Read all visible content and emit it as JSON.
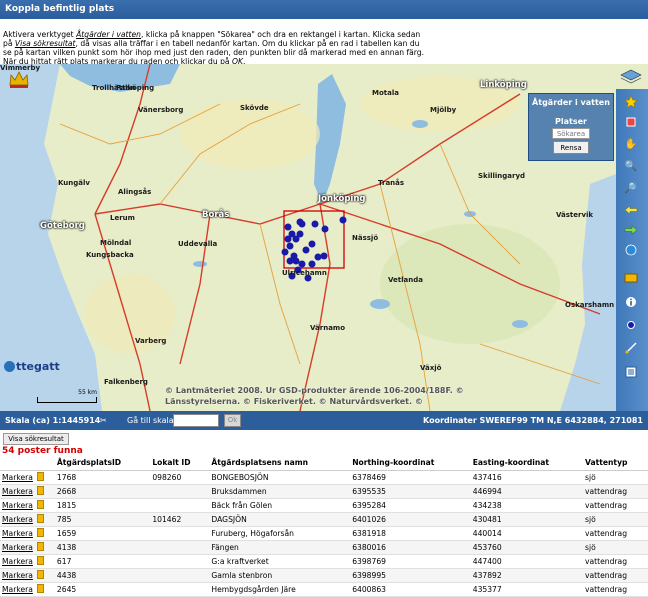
{
  "title": "Koppla befintlig plats",
  "instructions": {
    "line1_a": "Aktivera verktyget ",
    "line1_tool": "Åtgärder i vatten",
    "line1_b": ", klicka på knappen \"Sökarea\" och dra en rektangel i kartan. Klicka sedan",
    "line2_a": "på ",
    "line2_link": "Visa sökresultat",
    "line2_b": ", då visas alla träffar i en tabell nedanför kartan. Om du klickar på en rad i tabellen kan du",
    "line3": "se på kartan vilken punkt som hör ihop med just den raden, den punkten blir då markerad med en annan färg.",
    "line4_a": "När du hittat rätt plats markerar du raden och klickar du på ",
    "line4_ok": "OK",
    "line4_b": "."
  },
  "map": {
    "labels": [
      {
        "text": "Göteborg",
        "cls": "big"
      },
      {
        "text": "Borås",
        "cls": "big"
      },
      {
        "text": "Jönköping",
        "cls": "big"
      },
      {
        "text": "Linköping",
        "cls": "big"
      },
      {
        "text": "Alingsås",
        "cls": "med"
      },
      {
        "text": "Lerum",
        "cls": "med"
      },
      {
        "text": "Kungälv",
        "cls": "med"
      },
      {
        "text": "Mölndal",
        "cls": "med"
      },
      {
        "text": "Kungsbacka",
        "cls": "med"
      },
      {
        "text": "Varberg",
        "cls": "med"
      },
      {
        "text": "Falkenberg",
        "cls": "med"
      },
      {
        "text": "Värnamo",
        "cls": "med"
      },
      {
        "text": "Växjö",
        "cls": "med"
      },
      {
        "text": "Västervik",
        "cls": "med"
      },
      {
        "text": "Oskarshamn",
        "cls": "med"
      },
      {
        "text": "Vetlanda",
        "cls": "med"
      },
      {
        "text": "Nässjö",
        "cls": "med"
      },
      {
        "text": "Tranås",
        "cls": "med"
      },
      {
        "text": "Motala",
        "cls": "med"
      },
      {
        "text": "Mjölby",
        "cls": "med"
      },
      {
        "text": "Skövde",
        "cls": "med"
      },
      {
        "text": "Falköping",
        "cls": "med"
      },
      {
        "text": "Vänersborg",
        "cls": "med"
      },
      {
        "text": "Trollhättan",
        "cls": "med"
      },
      {
        "text": "Uddevalla",
        "cls": "med"
      },
      {
        "text": "Ulricehamn",
        "cls": "med"
      },
      {
        "text": "Skillingaryd",
        "cls": "med"
      },
      {
        "text": "Vimmerby",
        "cls": "med"
      }
    ],
    "copyright_1": "© Lantmäteriet 2008. Ur GSD-produkter ärende 106-2004/188F. ©",
    "copyright_2": "Länsstyrelserna. © Fiskeriverket. © Naturvårdsverket. ©",
    "logo": "ttegatt",
    "scale_label": "55 km",
    "panel_title": "Åtgärder i vatten",
    "panel_sub": "Platser",
    "search_placeholder": "Sökarea",
    "clear_label": "Rensa"
  },
  "status": {
    "scale": "Skala (ca) 1:1445914",
    "goto": "Gå till skala",
    "ok": "Ok",
    "coords": "Koordinater SWEREF99 TM N,E 6432884, 271081"
  },
  "show_results": "Visa sökresultat",
  "found": "54 poster funna",
  "table": {
    "headers": [
      "",
      "",
      "ÅtgärdsplatsID",
      "Lokalt ID",
      "Åtgärdsplatsens namn",
      "Northing-koordinat",
      "Easting-koordinat",
      "Vattentyp"
    ],
    "rows": [
      [
        "Markera",
        "1768",
        "098260",
        "BONGEBOSJÖN",
        "6378469",
        "437416",
        "sjö"
      ],
      [
        "Markera",
        "2668",
        "",
        "Bruksdammen",
        "6395535",
        "446994",
        "vattendrag"
      ],
      [
        "Markera",
        "1815",
        "",
        "Bäck från Gölen",
        "6395284",
        "434238",
        "vattendrag"
      ],
      [
        "Markera",
        "785",
        "101462",
        "DAGSJÖN",
        "6401026",
        "430481",
        "sjö"
      ],
      [
        "Markera",
        "1659",
        "",
        "Furuberg, Högaforsån",
        "6381918",
        "440014",
        "vattendrag"
      ],
      [
        "Markera",
        "4138",
        "",
        "Fängen",
        "6380016",
        "453760",
        "sjö"
      ],
      [
        "Markera",
        "617",
        "",
        "G:a kraftverket",
        "6398769",
        "447400",
        "vattendrag"
      ],
      [
        "Markera",
        "4438",
        "",
        "Gamla stenbron",
        "6398995",
        "437892",
        "vattendrag"
      ],
      [
        "Markera",
        "2645",
        "",
        "Hembygdsgården Järe",
        "6400863",
        "435377",
        "vattendrag"
      ]
    ]
  },
  "colors": {
    "header_bg": "#2c5e9c",
    "found_text": "#d40000",
    "marker": "#1a1aa8",
    "selection": "#d00000"
  }
}
